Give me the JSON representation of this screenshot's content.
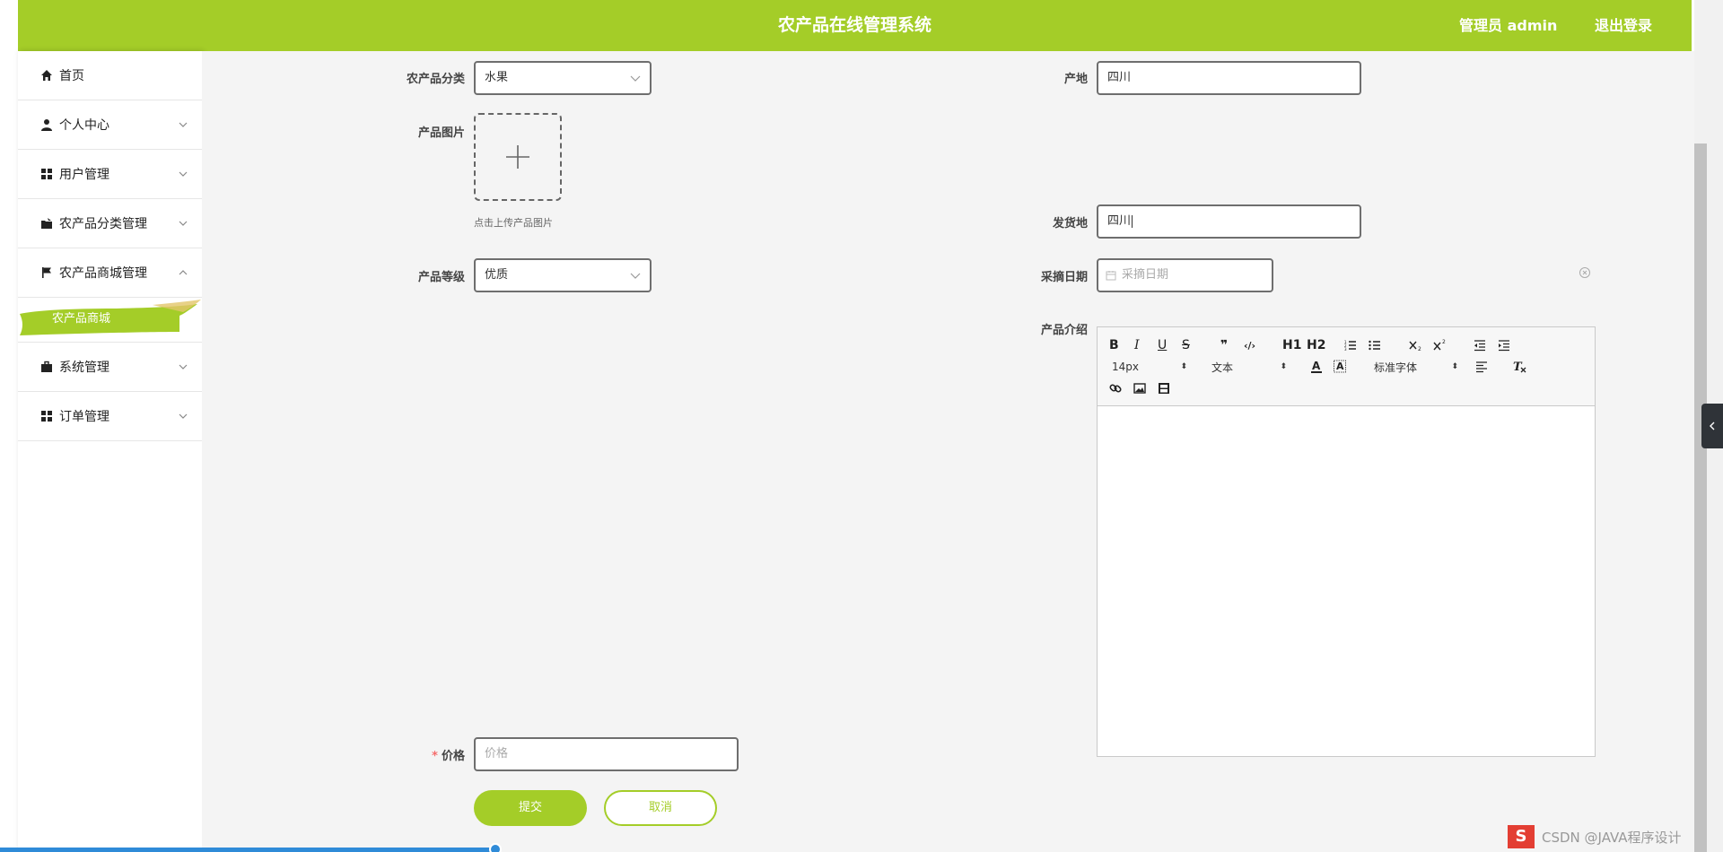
{
  "header": {
    "title": "农产品在线管理系统",
    "user": "管理员 admin",
    "logout": "退出登录"
  },
  "sidebar": {
    "items": [
      {
        "label": "首页",
        "icon": "home-icon"
      },
      {
        "label": "个人中心",
        "icon": "user-icon"
      },
      {
        "label": "用户管理",
        "icon": "grid-icon"
      },
      {
        "label": "农产品分类管理",
        "icon": "folder-icon"
      },
      {
        "label": "农产品商城管理",
        "icon": "flag-icon"
      },
      {
        "label": "系统管理",
        "icon": "briefcase-icon"
      },
      {
        "label": "订单管理",
        "icon": "grid-icon"
      }
    ],
    "active_sub": "农产品商城"
  },
  "form": {
    "category": {
      "label": "农产品分类",
      "value": "水果"
    },
    "origin": {
      "label": "产地",
      "value": "四川"
    },
    "image": {
      "label": "产品图片",
      "hint": "点击上传产品图片"
    },
    "ship_from": {
      "label": "发货地",
      "value": "四川"
    },
    "grade": {
      "label": "产品等级",
      "value": "优质"
    },
    "pick_date": {
      "label": "采摘日期",
      "placeholder": "采摘日期"
    },
    "intro": {
      "label": "产品介绍"
    },
    "price": {
      "label": "价格",
      "placeholder": "价格"
    }
  },
  "editor": {
    "font_size": "14px",
    "text_style": "文本",
    "font_family": "标准字体",
    "h1": "H1",
    "h2": "H2",
    "bold": "B",
    "italic": "I",
    "underline": "U",
    "strike": "S",
    "quote": "❞",
    "code": "‹/›"
  },
  "buttons": {
    "submit": "提交",
    "cancel": "取消"
  },
  "watermark": {
    "logo": "S",
    "text": "CSDN @JAVA程序设计"
  },
  "colors": {
    "accent": "#a4cd28",
    "background": "#f4f4f4"
  }
}
